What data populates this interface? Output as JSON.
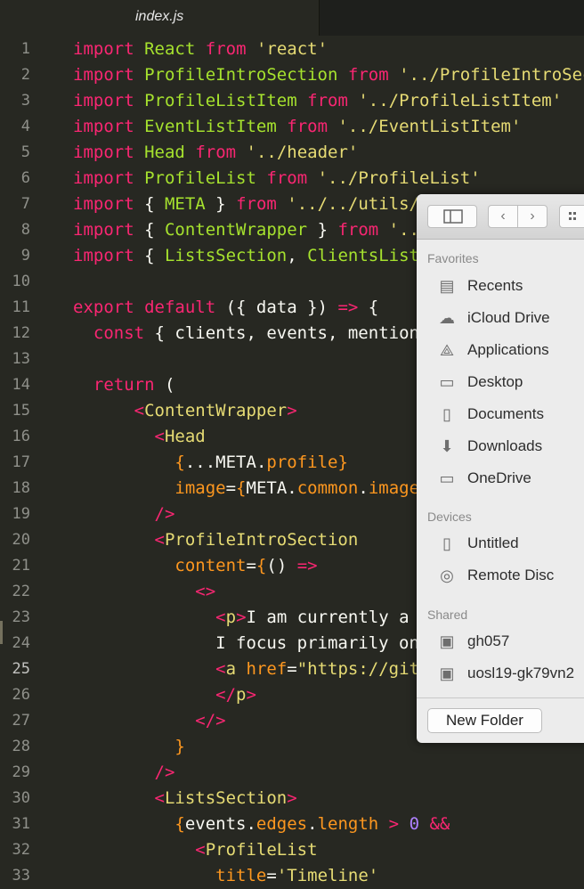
{
  "tab": {
    "title": "index.js"
  },
  "editor": {
    "lines": [
      {
        "n": "1",
        "html": "<span class='k'>import</span> <span class='c'>React</span> <span class='k'>from</span> <span class='s'>'react'</span>"
      },
      {
        "n": "2",
        "html": "<span class='k'>import</span> <span class='c'>ProfileIntroSection</span> <span class='k'>from</span> <span class='s'>'../ProfileIntroSec</span>"
      },
      {
        "n": "3",
        "html": "<span class='k'>import</span> <span class='c'>ProfileListItem</span> <span class='k'>from</span> <span class='s'>'../ProfileListItem'</span>"
      },
      {
        "n": "4",
        "html": "<span class='k'>import</span> <span class='c'>EventListItem</span> <span class='k'>from</span> <span class='s'>'../EventListItem'</span>"
      },
      {
        "n": "5",
        "html": "<span class='k'>import</span> <span class='c'>Head</span> <span class='k'>from</span> <span class='s'>'../header'</span>"
      },
      {
        "n": "6",
        "html": "<span class='k'>import</span> <span class='c'>ProfileList</span> <span class='k'>from</span> <span class='s'>'../ProfileList'</span>"
      },
      {
        "n": "7",
        "html": "<span class='k'>import</span> { <span class='c'>META</span> } <span class='k'>from</span> <span class='s'>'../../utils/</span>"
      },
      {
        "n": "8",
        "html": "<span class='k'>import</span> { <span class='c'>ContentWrapper</span> } <span class='k'>from</span> <span class='s'>'..</span>"
      },
      {
        "n": "9",
        "html": "<span class='k'>import</span> { <span class='c'>ListsSection</span>, <span class='c'>ClientsList</span>"
      },
      {
        "n": "10",
        "html": ""
      },
      {
        "n": "11",
        "html": "<span class='k'>export</span> <span class='k'>default</span> ({ data }) <span class='k'>=&gt;</span> {"
      },
      {
        "n": "12",
        "html": "  <span class='k'>const</span> { clients, events, mention"
      },
      {
        "n": "13",
        "html": ""
      },
      {
        "n": "14",
        "html": "  <span class='k'>return</span> ("
      },
      {
        "n": "15",
        "html": "      <span class='t'>&lt;</span><span class='tn'>ContentWrapper</span><span class='t'>&gt;</span>"
      },
      {
        "n": "16",
        "html": "        <span class='t'>&lt;</span><span class='tn'>Head</span>"
      },
      {
        "n": "17",
        "html": "          <span class='b'>{</span>...<span class='x'>META</span>.<span class='pr'>profile</span><span class='b'>}</span>"
      },
      {
        "n": "18",
        "html": "          <span class='at'>image</span>=<span class='b'>{</span><span class='x'>META</span>.<span class='pr'>common</span>.<span class='pr'>image</span>"
      },
      {
        "n": "19",
        "html": "        <span class='t'>/&gt;</span>"
      },
      {
        "n": "20",
        "html": "        <span class='t'>&lt;</span><span class='tn'>ProfileIntroSection</span>"
      },
      {
        "n": "21",
        "html": "          <span class='at'>content</span>=<span class='b'>{</span>() <span class='k'>=&gt;</span>"
      },
      {
        "n": "22",
        "html": "            <span class='t'>&lt;&gt;</span>"
      },
      {
        "n": "23",
        "html": "              <span class='t'>&lt;</span><span class='tn'>p</span><span class='t'>&gt;</span>I am currently a "
      },
      {
        "n": "24",
        "html": "              I focus primarily on"
      },
      {
        "n": "25",
        "html": "              <span class='t'>&lt;</span><span class='tn'>a</span> <span class='at'>href</span>=<span class='s'>\"https://git</span>"
      },
      {
        "n": "26",
        "html": "              <span class='t'>&lt;/</span><span class='tn'>p</span><span class='t'>&gt;</span>"
      },
      {
        "n": "27",
        "html": "            <span class='t'>&lt;/&gt;</span>"
      },
      {
        "n": "28",
        "html": "          <span class='b'>}</span>"
      },
      {
        "n": "29",
        "html": "        <span class='t'>/&gt;</span>"
      },
      {
        "n": "30",
        "html": "        <span class='t'>&lt;</span><span class='tn'>ListsSection</span><span class='t'>&gt;</span>"
      },
      {
        "n": "31",
        "html": "          <span class='b'>{</span>events.<span class='pr'>edges</span>.<span class='pr'>length</span> <span class='k'>&gt;</span> <span class='n'>0</span> <span class='k'>&amp;&amp;</span>"
      },
      {
        "n": "32",
        "html": "            <span class='t'>&lt;</span><span class='tn'>ProfileList</span>"
      },
      {
        "n": "33",
        "html": "              <span class='at'>title</span>=<span class='s'>'Timeline'</span>"
      }
    ]
  },
  "dialog": {
    "sections": {
      "favorites": "Favorites",
      "devices": "Devices",
      "shared": "Shared"
    },
    "favorites": [
      {
        "label": "Recents",
        "icon": "recents-icon"
      },
      {
        "label": "iCloud Drive",
        "icon": "cloud-icon"
      },
      {
        "label": "Applications",
        "icon": "applications-icon"
      },
      {
        "label": "Desktop",
        "icon": "desktop-icon"
      },
      {
        "label": "Documents",
        "icon": "documents-icon"
      },
      {
        "label": "Downloads",
        "icon": "downloads-icon"
      },
      {
        "label": "OneDrive",
        "icon": "folder-icon"
      }
    ],
    "devices": [
      {
        "label": "Untitled",
        "icon": "disk-icon"
      },
      {
        "label": "Remote Disc",
        "icon": "disc-icon"
      }
    ],
    "shared": [
      {
        "label": "gh057",
        "icon": "computer-icon"
      },
      {
        "label": "uosl19-gk79vn2",
        "icon": "computer-icon"
      }
    ],
    "new_folder_label": "New Folder"
  }
}
